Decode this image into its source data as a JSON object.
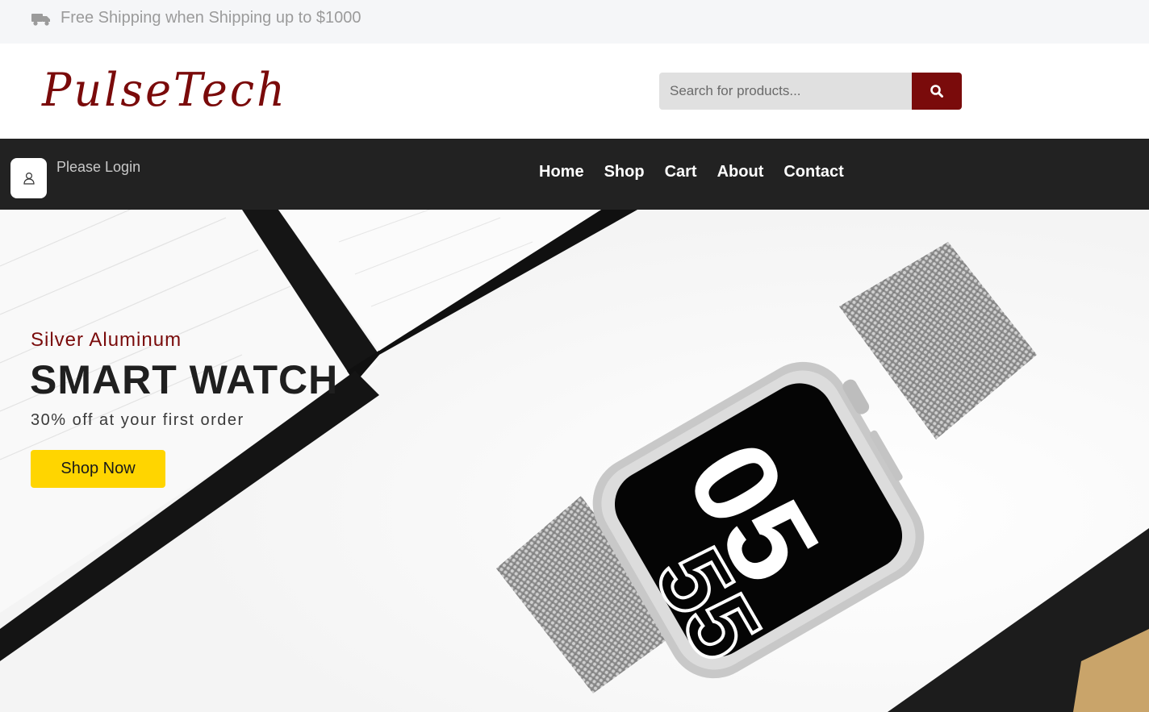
{
  "topbar": {
    "shipping_text": "Free Shipping when Shipping up to $1000",
    "icon": "truck-icon"
  },
  "header": {
    "logo_text": "PulseTech",
    "search": {
      "placeholder": "Search for products...",
      "value": "",
      "button_icon": "search-icon"
    }
  },
  "navbar": {
    "user_icon": "user-icon",
    "login_text": "Please Login",
    "links": [
      "Home",
      "Shop",
      "Cart",
      "About",
      "Contact"
    ]
  },
  "hero": {
    "subtitle": "Silver Aluminum",
    "title": "SMART WATCH",
    "offer": "30% off at your first order",
    "cta_label": "Shop Now",
    "watch_face_digits": "05 55"
  },
  "colors": {
    "brand": "#7a0b0b",
    "nav_bg": "#222222",
    "cta": "#ffd500",
    "topbar_bg": "#f5f6f8"
  }
}
